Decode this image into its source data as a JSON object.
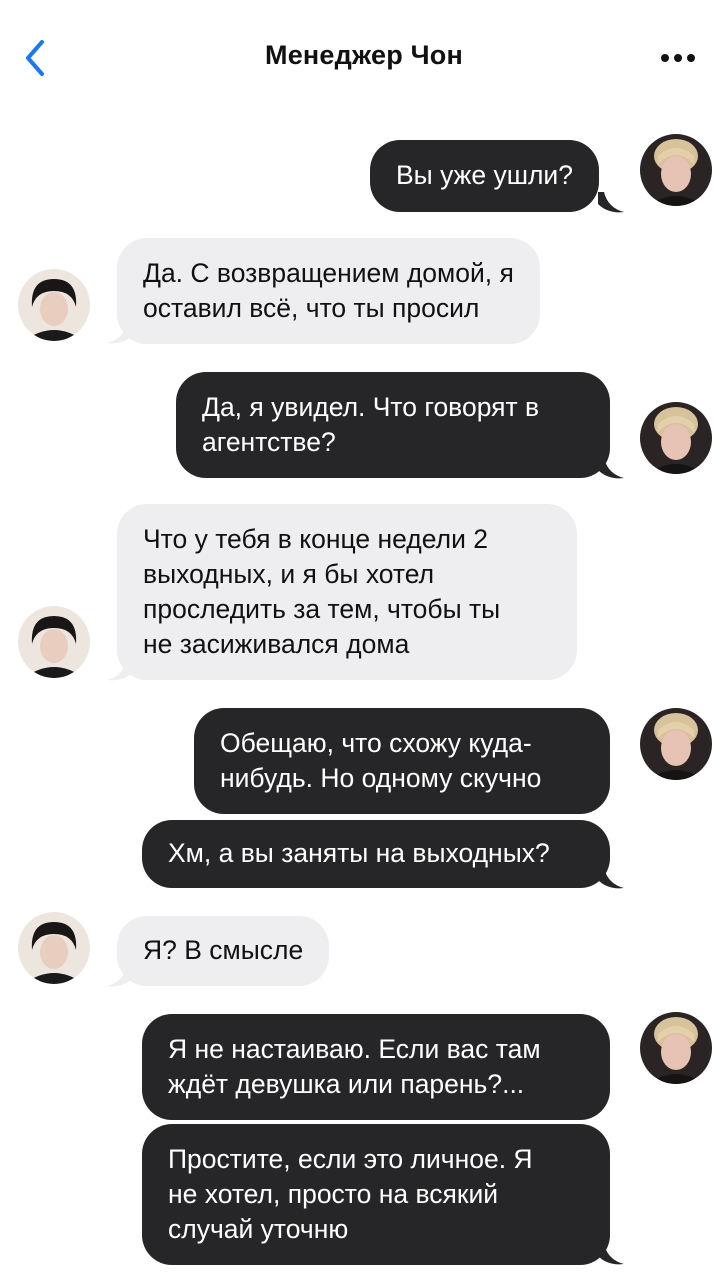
{
  "header": {
    "title": "Менеджер Чон",
    "back_icon": "chevron-left-icon",
    "more_icon": "ellipsis-icon"
  },
  "colors": {
    "accent": "#1a78f2",
    "outgoing_bubble": "#262628",
    "incoming_bubble": "#eeeef1"
  },
  "messages": [
    {
      "from": "me",
      "text": "Вы уже ушли?"
    },
    {
      "from": "them",
      "text": "Да. С возвращением домой, я\nоставил всё, что ты просил"
    },
    {
      "from": "me",
      "text": "Да, я увидел. Что говорят в\nагентстве?"
    },
    {
      "from": "them",
      "text": "Что у тебя в конце недели 2\nвыходных, и я бы хотел\nпроследить за тем, чтобы ты\nне засиживался дома"
    },
    {
      "from": "me",
      "text": "Обещаю, что схожу куда-\nнибудь. Но одному скучно"
    },
    {
      "from": "me",
      "text": "Хм, а вы заняты на выходных?"
    },
    {
      "from": "them",
      "text": "Я? В смысле"
    },
    {
      "from": "me",
      "text": "Я не настаиваю. Если вас там\nждёт девушка или парень?..."
    },
    {
      "from": "me",
      "text": "Простите, если это личное. Я\nне хотел, просто на всякий\nслучай уточню"
    }
  ]
}
